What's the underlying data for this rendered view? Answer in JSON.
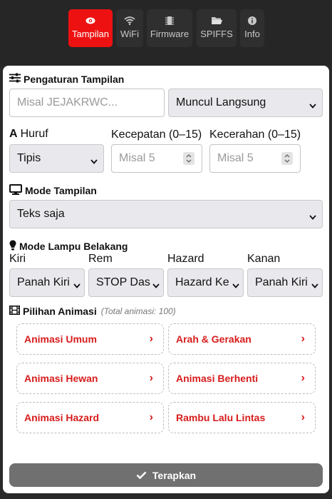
{
  "tabs": [
    {
      "label": "Tampilan",
      "icon": "eye-icon"
    },
    {
      "label": "WiFi",
      "icon": "wifi-icon"
    },
    {
      "label": "Firmware",
      "icon": "chip-icon"
    },
    {
      "label": "SPIFFS",
      "icon": "folder-icon"
    },
    {
      "label": "Info",
      "icon": "info-icon"
    }
  ],
  "display_settings": {
    "title": "Pengaturan Tampilan",
    "text_placeholder": "Misal JEJAKRWC...",
    "effect_value": "Muncul Langsung"
  },
  "font": {
    "label": "Huruf",
    "value": "Tipis"
  },
  "speed": {
    "label": "Kecepatan (0–15)",
    "placeholder": "Misal 5"
  },
  "brightness": {
    "label": "Kecerahan (0–15)",
    "placeholder": "Misal 5"
  },
  "display_mode": {
    "title": "Mode Tampilan",
    "value": "Teks saja"
  },
  "rear_lamp": {
    "title": "Mode Lampu Belakang",
    "left_label": "Kiri",
    "left_value": "Panah Kiri",
    "brake_label": "Rem",
    "brake_value": "STOP Das",
    "hazard_label": "Hazard",
    "hazard_value": "Hazard Ke",
    "right_label": "Kanan",
    "right_value": "Panah Kiri"
  },
  "animations": {
    "title": "Pilihan Animasi",
    "total": "(Total animasi: 100)",
    "items": [
      "Animasi Umum",
      "Arah & Gerakan",
      "Animasi Hewan",
      "Animasi Berhenti",
      "Animasi Hazard",
      "Rambu Lalu Lintas"
    ],
    "chevron": "›"
  },
  "apply_label": "Terapkan",
  "colors": {
    "accent": "#ee1111",
    "animation_text": "#d81b1b",
    "topbar": "#262626",
    "apply_button": "#707070"
  }
}
